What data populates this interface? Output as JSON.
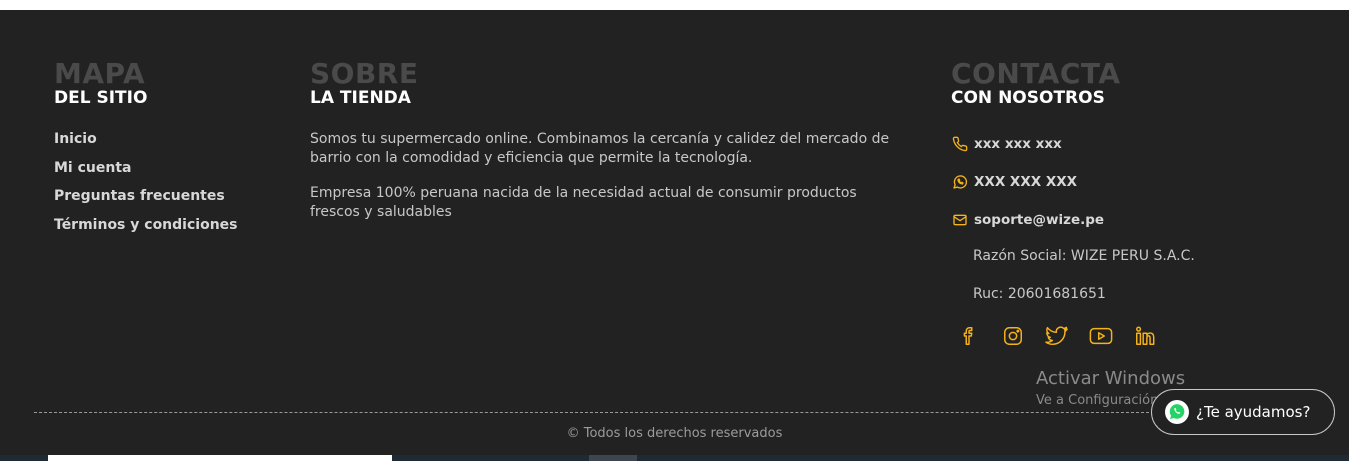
{
  "colors": {
    "background": "#222222",
    "accent": "#f5b21a",
    "title_muted": "#4a4a4a",
    "text": "#d8d8d8"
  },
  "sitemap": {
    "big_title": "MAPA",
    "sub_title": "DEL SITIO",
    "links": [
      "Inicio",
      "Mi cuenta",
      "Preguntas frecuentes",
      "Términos y condiciones"
    ]
  },
  "about": {
    "big_title": "SOBRE",
    "sub_title": "LA TIENDA",
    "paragraph_1": "Somos tu supermercado online. Combinamos la cercanía y calidez del mercado de barrio con la comodidad y eficiencia que permite la tecnología.",
    "paragraph_2": "Empresa 100% peruana nacida de la necesidad actual de consumir productos frescos y saludables"
  },
  "contact": {
    "big_title": "CONTACTA",
    "sub_title": "CON NOSOTROS",
    "phone": "xxx xxx xxx",
    "whatsapp": "XXX XXX XXX",
    "email": "soporte@wize.pe",
    "razon_social": "Razón Social: WIZE PERU S.A.C.",
    "ruc": "Ruc: 20601681651",
    "socials": [
      "facebook-icon",
      "instagram-icon",
      "twitter-icon",
      "youtube-icon",
      "linkedin-icon"
    ]
  },
  "copyright": "© Todos los derechos reservados",
  "watermark": {
    "line1": "Activar Windows",
    "line2": "Ve a Configuración para activar Windows."
  },
  "help_button": {
    "label": "¿Te ayudamos?",
    "icon": "whatsapp-icon"
  }
}
